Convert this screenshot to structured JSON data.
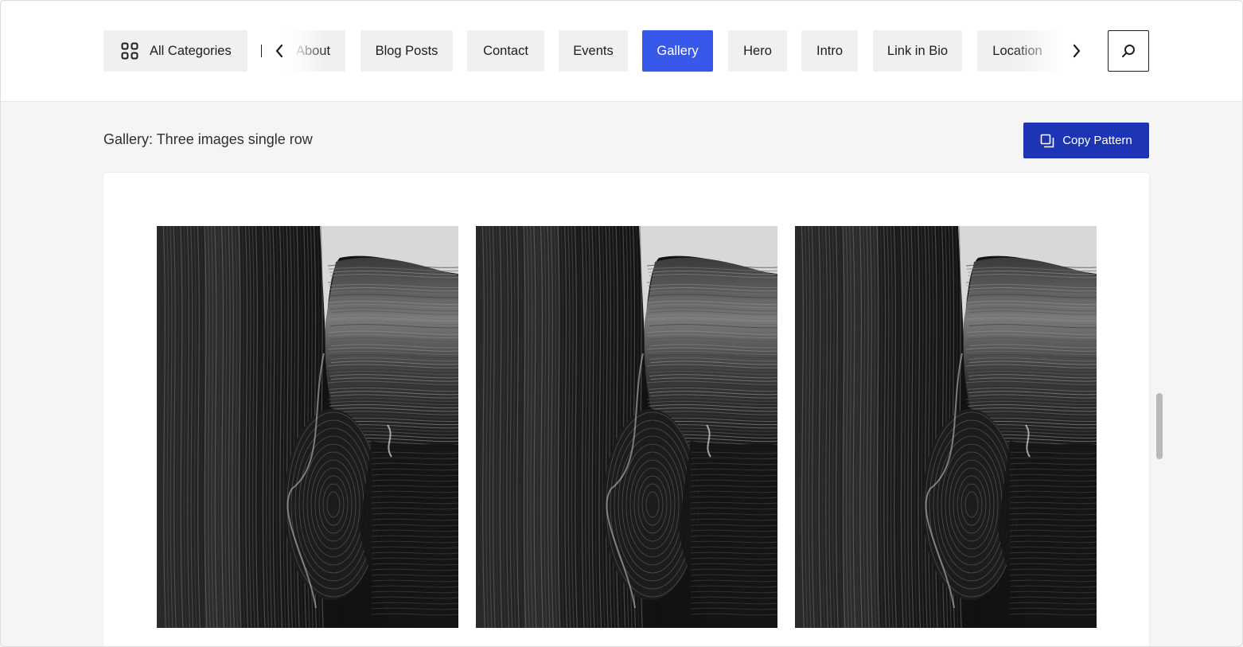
{
  "categories": {
    "all_label": "All Categories",
    "items": [
      {
        "label": "About"
      },
      {
        "label": "Blog Posts"
      },
      {
        "label": "Contact"
      },
      {
        "label": "Events"
      },
      {
        "label": "Gallery",
        "active": true
      },
      {
        "label": "Hero"
      },
      {
        "label": "Intro"
      },
      {
        "label": "Link in Bio"
      },
      {
        "label": "Location"
      }
    ],
    "active": "Gallery"
  },
  "icons": {
    "all_categories": "grid-icon",
    "scroll_left": "chevron-left-icon",
    "scroll_right": "chevron-right-icon",
    "search": "search-icon",
    "copy": "copy-icon"
  },
  "pattern": {
    "title": "Gallery: Three images single row",
    "copy_label": "Copy Pattern"
  },
  "gallery": {
    "image_count": 3,
    "image_description": "black and white abstract paint texture"
  },
  "colors": {
    "accent": "#3858e9",
    "button_dark": "#1d35b4",
    "chip_bg": "#f0f0f0",
    "page_bg": "#f4f5f4"
  }
}
